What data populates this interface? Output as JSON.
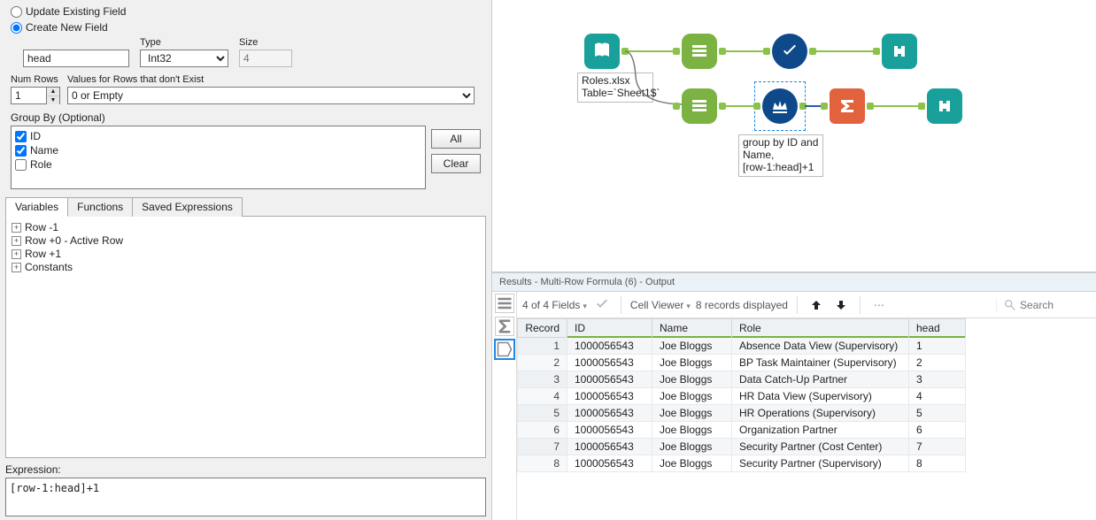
{
  "config": {
    "radio_update": "Update Existing Field",
    "radio_create": "Create New  Field",
    "field_name_value": "head",
    "type_label": "Type",
    "type_value": "Int32",
    "size_label": "Size",
    "size_value": "4",
    "numrows_label": "Num Rows",
    "numrows_value": "1",
    "values_label": "Values for Rows that don't Exist",
    "values_value": "0 or Empty",
    "groupby_label": "Group By (Optional)",
    "groupby_items": [
      {
        "label": "ID",
        "checked": true
      },
      {
        "label": "Name",
        "checked": true
      },
      {
        "label": "Role",
        "checked": false
      }
    ],
    "btn_all": "All",
    "btn_clear": "Clear"
  },
  "tabs": {
    "items": [
      "Variables",
      "Functions",
      "Saved Expressions"
    ],
    "tree": [
      "Row -1",
      "Row +0 - Active Row",
      "Row +1",
      "Constants"
    ]
  },
  "expression": {
    "label": "Expression:",
    "value": "[row-1:head]+1"
  },
  "canvas": {
    "input_label": "Roles.xlsx\nTable=`Sheet1$`",
    "formula_label": "group by ID and\nName,\n[row-1:head]+1"
  },
  "results": {
    "header": "Results - Multi-Row Formula (6) - Output",
    "fields_text": "4 of 4 Fields",
    "cellviewer": "Cell Viewer",
    "records_text": "8 records displayed",
    "search_placeholder": "Search",
    "columns": [
      "Record",
      "ID",
      "Name",
      "Role",
      "head"
    ],
    "rows": [
      {
        "rec": "1",
        "id": "1000056543",
        "name": "Joe Bloggs",
        "role": "Absence Data View (Supervisory)",
        "head": "1"
      },
      {
        "rec": "2",
        "id": "1000056543",
        "name": "Joe Bloggs",
        "role": "BP Task Maintainer (Supervisory)",
        "head": "2"
      },
      {
        "rec": "3",
        "id": "1000056543",
        "name": "Joe Bloggs",
        "role": "Data Catch-Up Partner",
        "head": "3"
      },
      {
        "rec": "4",
        "id": "1000056543",
        "name": "Joe Bloggs",
        "role": "HR Data View (Supervisory)",
        "head": "4"
      },
      {
        "rec": "5",
        "id": "1000056543",
        "name": "Joe Bloggs",
        "role": "HR Operations (Supervisory)",
        "head": "5"
      },
      {
        "rec": "6",
        "id": "1000056543",
        "name": "Joe Bloggs",
        "role": "Organization Partner",
        "head": "6"
      },
      {
        "rec": "7",
        "id": "1000056543",
        "name": "Joe Bloggs",
        "role": "Security Partner (Cost Center)",
        "head": "7"
      },
      {
        "rec": "8",
        "id": "1000056543",
        "name": "Joe Bloggs",
        "role": "Security Partner (Supervisory)",
        "head": "8"
      }
    ]
  }
}
